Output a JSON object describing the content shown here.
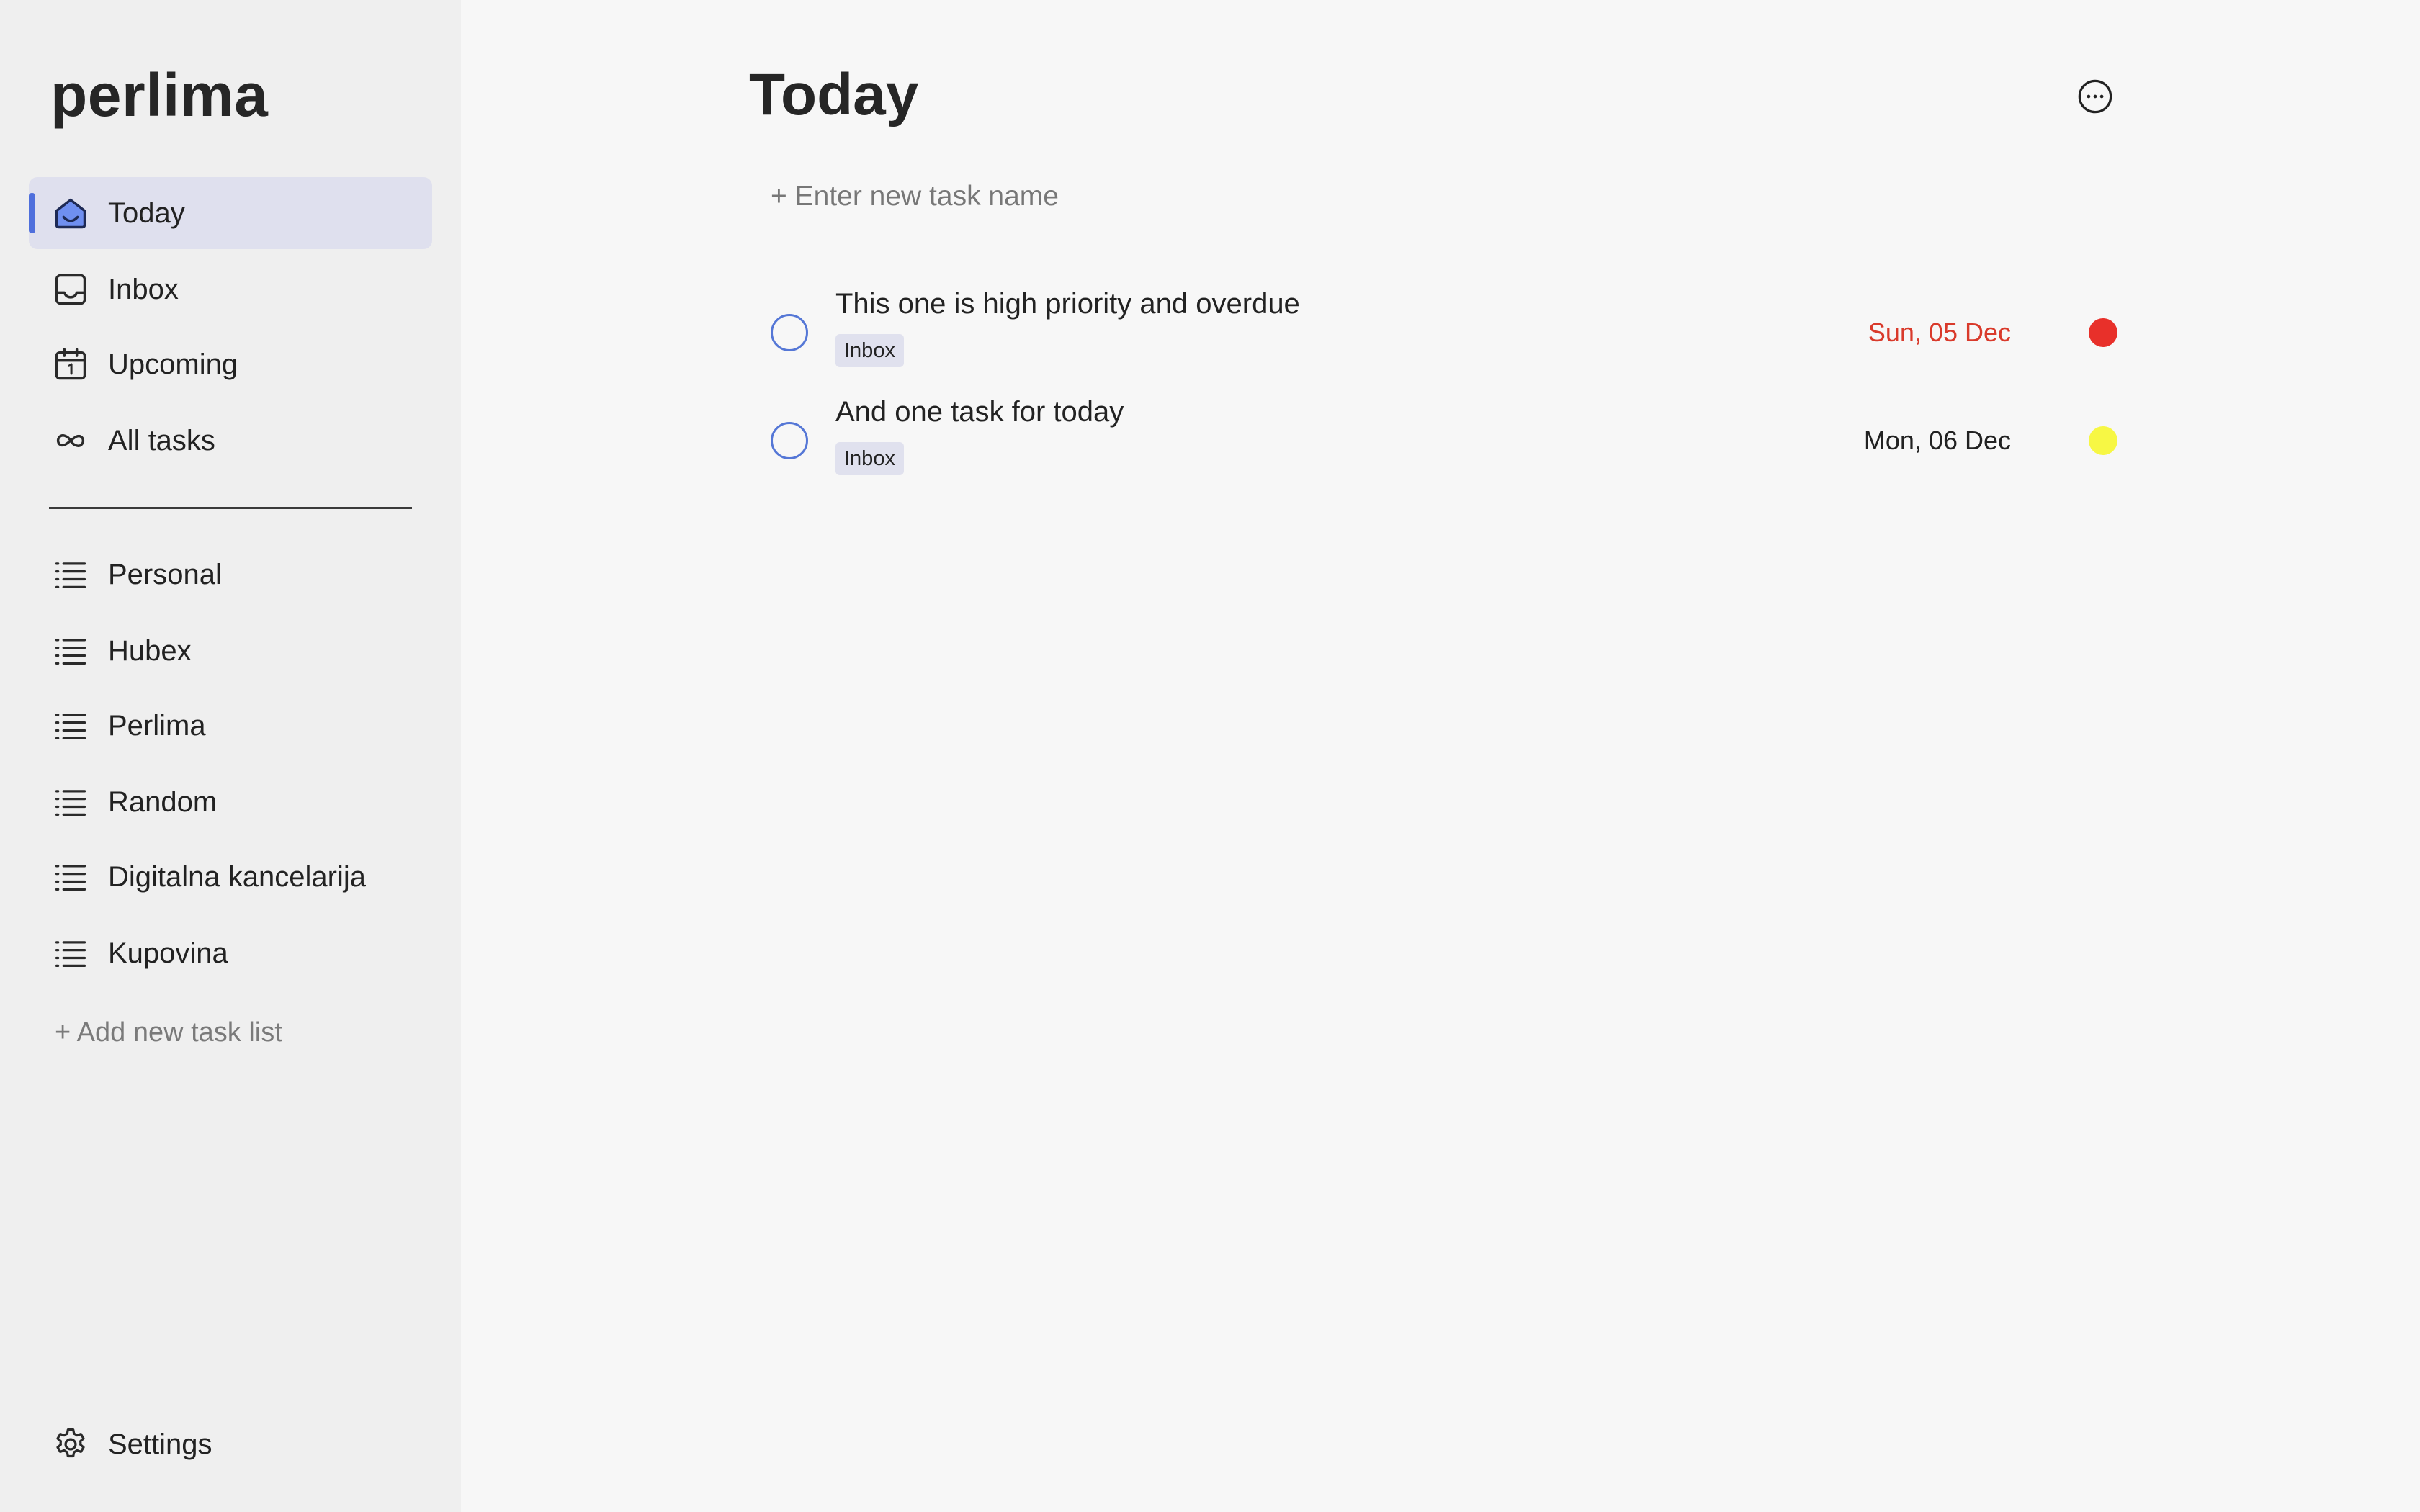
{
  "app": {
    "name": "perlima"
  },
  "sidebar": {
    "nav": [
      {
        "label": "Today",
        "icon": "home-icon",
        "active": true
      },
      {
        "label": "Inbox",
        "icon": "inbox-icon",
        "active": false
      },
      {
        "label": "Upcoming",
        "icon": "calendar-icon",
        "active": false
      },
      {
        "label": "All tasks",
        "icon": "infinity-icon",
        "active": false
      }
    ],
    "lists": [
      {
        "label": "Personal",
        "icon": "list-icon"
      },
      {
        "label": "Hubex",
        "icon": "list-icon"
      },
      {
        "label": "Perlima",
        "icon": "list-icon"
      },
      {
        "label": "Random",
        "icon": "list-icon"
      },
      {
        "label": "Digitalna kancelarija",
        "icon": "list-icon"
      },
      {
        "label": "Kupovina",
        "icon": "list-icon"
      }
    ],
    "add_list_label": "+ Add new task list",
    "settings": {
      "label": "Settings",
      "icon": "gear-icon"
    }
  },
  "main": {
    "title": "Today",
    "more_icon": "more-horizontal-icon",
    "new_task_placeholder": "+ Enter new task name",
    "tasks": [
      {
        "title": "This one is high priority and overdue",
        "list": "Inbox",
        "due": "Sun, 05 Dec",
        "overdue": true,
        "priority": "high",
        "priority_color": "#e8302a",
        "due_color": "#d93a2b"
      },
      {
        "title": "And one task for today",
        "list": "Inbox",
        "due": "Mon, 06 Dec",
        "overdue": false,
        "priority": "medium",
        "priority_color": "#f7f744",
        "due_color": "#222222"
      }
    ]
  },
  "colors": {
    "accent": "#4f6fdc",
    "active_bg": "#dfe0ee",
    "sidebar_bg": "#efefef",
    "main_bg": "#f7f7f7"
  }
}
